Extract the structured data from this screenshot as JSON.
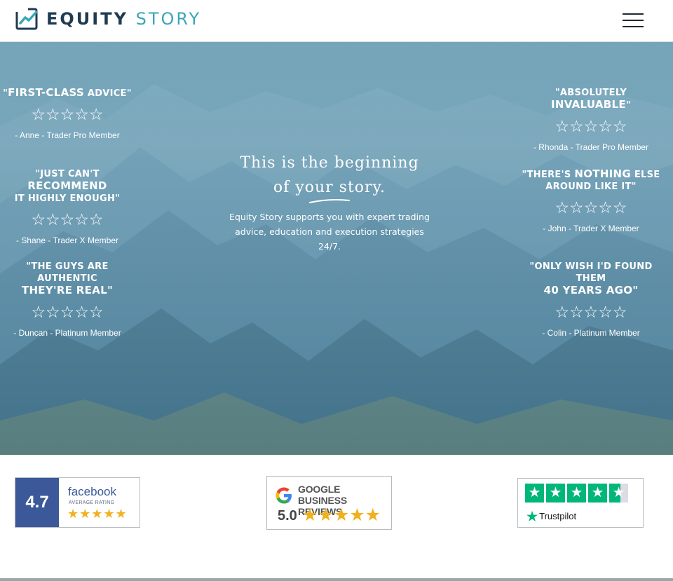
{
  "header": {
    "logo_word1": "EQUITY",
    "logo_word2": "STORY",
    "menu_icon": "hamburger-menu-icon"
  },
  "colors": {
    "brand_dark": "#1f3b52",
    "brand_teal": "#3aa7b5",
    "facebook_blue": "#3b5998",
    "star_gold": "#f2b01e",
    "trustpilot_green": "#00b67a"
  },
  "hero": {
    "headline_line1": "This is the beginning",
    "headline_line2": "of your story.",
    "subtext": "Equity Story supports you with expert trading advice, education and execution strategies 24/7."
  },
  "testimonials": [
    {
      "pre": "\"",
      "big": "First-class",
      "post": " advice\"",
      "line2": "",
      "stars": "☆☆☆☆☆",
      "rating": 0,
      "author": "- Anne - Trader Pro Member"
    },
    {
      "pre": "\"Just can't ",
      "big": "recommend",
      "post": "",
      "line2": "it highly enough\"",
      "stars": "☆☆☆☆☆",
      "rating": 0,
      "author": "- Shane - Trader X Member"
    },
    {
      "pre": "\"The guys are authentic",
      "big": "",
      "post": "",
      "line2": "they're real\"",
      "stars": "☆☆☆☆☆",
      "rating": 0,
      "author": "- Duncan - Platinum Member"
    },
    {
      "pre": "\"Absolutely ",
      "big": "invaluable",
      "post": "\"",
      "line2": "",
      "stars": "☆☆☆☆☆",
      "rating": 0,
      "author": "- Rhonda - Trader Pro Member"
    },
    {
      "pre": "\"There's ",
      "big": "nothing",
      "post": " else",
      "line2": "around like it\"",
      "stars": "☆☆☆☆☆",
      "rating": 0,
      "author": "- John - Trader X Member"
    },
    {
      "pre": "\"Only wish I'd found them",
      "big": "",
      "post": "",
      "line2": "40 years ago\"",
      "stars": "☆☆☆☆☆",
      "rating": 0,
      "author": "- Colin - Platinum Member"
    }
  ],
  "reviews": {
    "facebook": {
      "score": "4.7",
      "name": "facebook",
      "label": "AVERAGE RATING",
      "stars": "★★★★★",
      "rating": 4.7
    },
    "google": {
      "line1": "GOOGLE",
      "line2": "BUSINESS REVIEWS",
      "score": "5.0",
      "stars": "★★★★★",
      "rating": 5.0
    },
    "trustpilot": {
      "name": "Trustpilot",
      "stars": "★",
      "rating": 4.5
    }
  }
}
